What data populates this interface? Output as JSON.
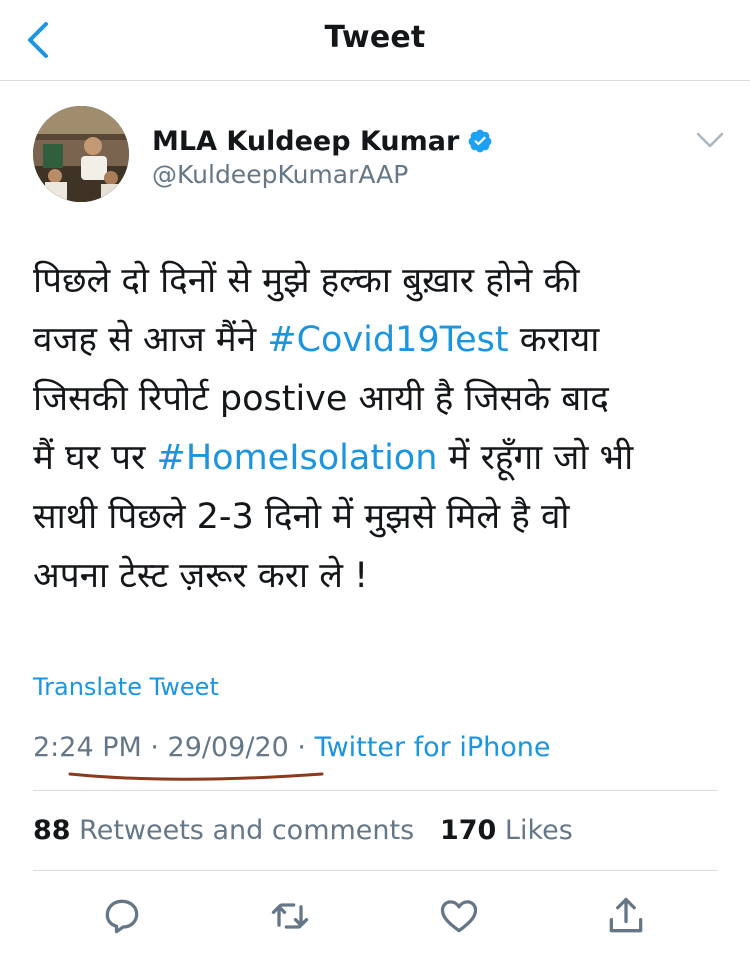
{
  "header": {
    "title": "Tweet",
    "back_icon": "chevron-left-icon"
  },
  "tweet": {
    "author": {
      "name": "MLA Kuldeep Kumar",
      "handle": "@KuldeepKumarAAP",
      "verified": true
    },
    "text": {
      "line1": "पिछले दो दिनों से मुझे हल्का बुख़ार होने की",
      "line2_pre": "वजह से आज मैंने ",
      "hashtag1": "#Covid19Test",
      "line2_post": " कराया",
      "line3": "जिसकी रिपोर्ट postive आयी है जिसके बाद",
      "line4_pre": "मैं घर पर ",
      "hashtag2": "#HomeIsolation",
      "line4_post": " में रहूँगा जो भी",
      "line5": "साथी पिछले 2-3 दिनो में मुझसे मिले है वो",
      "line6": "अपना टेस्ट ज़रूर करा ले !"
    },
    "translate_label": "Translate Tweet",
    "time": "2:24 PM",
    "date": "29/09/20",
    "separator": " · ",
    "source": "Twitter for iPhone",
    "stats": {
      "retweets_count": "88",
      "retweets_label": "Retweets and comments",
      "likes_count": "170",
      "likes_label": "Likes"
    }
  },
  "colors": {
    "link": "#1b95e0",
    "secondary": "#657786",
    "annotation": "#8b3a1e"
  },
  "actions": [
    "comment-icon",
    "retweet-icon",
    "like-icon",
    "share-icon"
  ]
}
